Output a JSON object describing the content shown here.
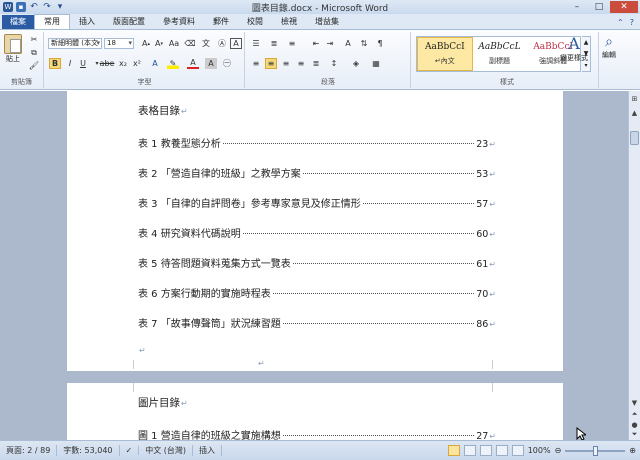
{
  "window": {
    "title": "圖表目錄.docx - Microsoft Word"
  },
  "tabs": [
    "檔案",
    "常用",
    "插入",
    "版面配置",
    "參考資料",
    "郵件",
    "校閱",
    "檢視",
    "增益集"
  ],
  "active_tab": "常用",
  "ribbon": {
    "clipboard": {
      "paste_label": "貼上",
      "group_label": "剪貼簿"
    },
    "font": {
      "font_name": "新細明體 (本文",
      "font_size": "18",
      "group_label": "字型"
    },
    "paragraph": {
      "group_label": "段落"
    },
    "styles": {
      "items": [
        {
          "sample": "AaBbCcI",
          "name": "↵內文"
        },
        {
          "sample": "AaBbCcL",
          "name": "副標題"
        },
        {
          "sample": "AaBbCcI",
          "name": "強調斜體"
        }
      ],
      "change_styles_label": "變更樣式",
      "group_label": "樣式"
    },
    "editing": {
      "label": "編輯"
    }
  },
  "document": {
    "table_heading": "表格目錄",
    "table_entries": [
      {
        "label": "表 1  教養型態分析",
        "page": "23"
      },
      {
        "label": "表 2 「營造自律的班級」之教學方案",
        "page": "53"
      },
      {
        "label": "表 3 「自律的自評問卷」參考專家意見及修正情形",
        "page": "57"
      },
      {
        "label": "表 4  研究資料代碼說明",
        "page": "60"
      },
      {
        "label": "表 5  待答問題資料蒐集方式一覽表",
        "page": "61"
      },
      {
        "label": "表 6  方案行動期的實施時程表",
        "page": "70"
      },
      {
        "label": "表 7 「故事傳聲筒」狀況練習題",
        "page": "86"
      }
    ],
    "figure_heading": "圖片目錄",
    "figure_entries": [
      {
        "label": "圖 1  營造自律的班級之實施構想",
        "page": "27"
      }
    ]
  },
  "status": {
    "page": "頁面: 2 / 89",
    "words": "字數: 53,040",
    "language": "中文 (台灣)",
    "mode": "插入",
    "zoom": "100%"
  }
}
